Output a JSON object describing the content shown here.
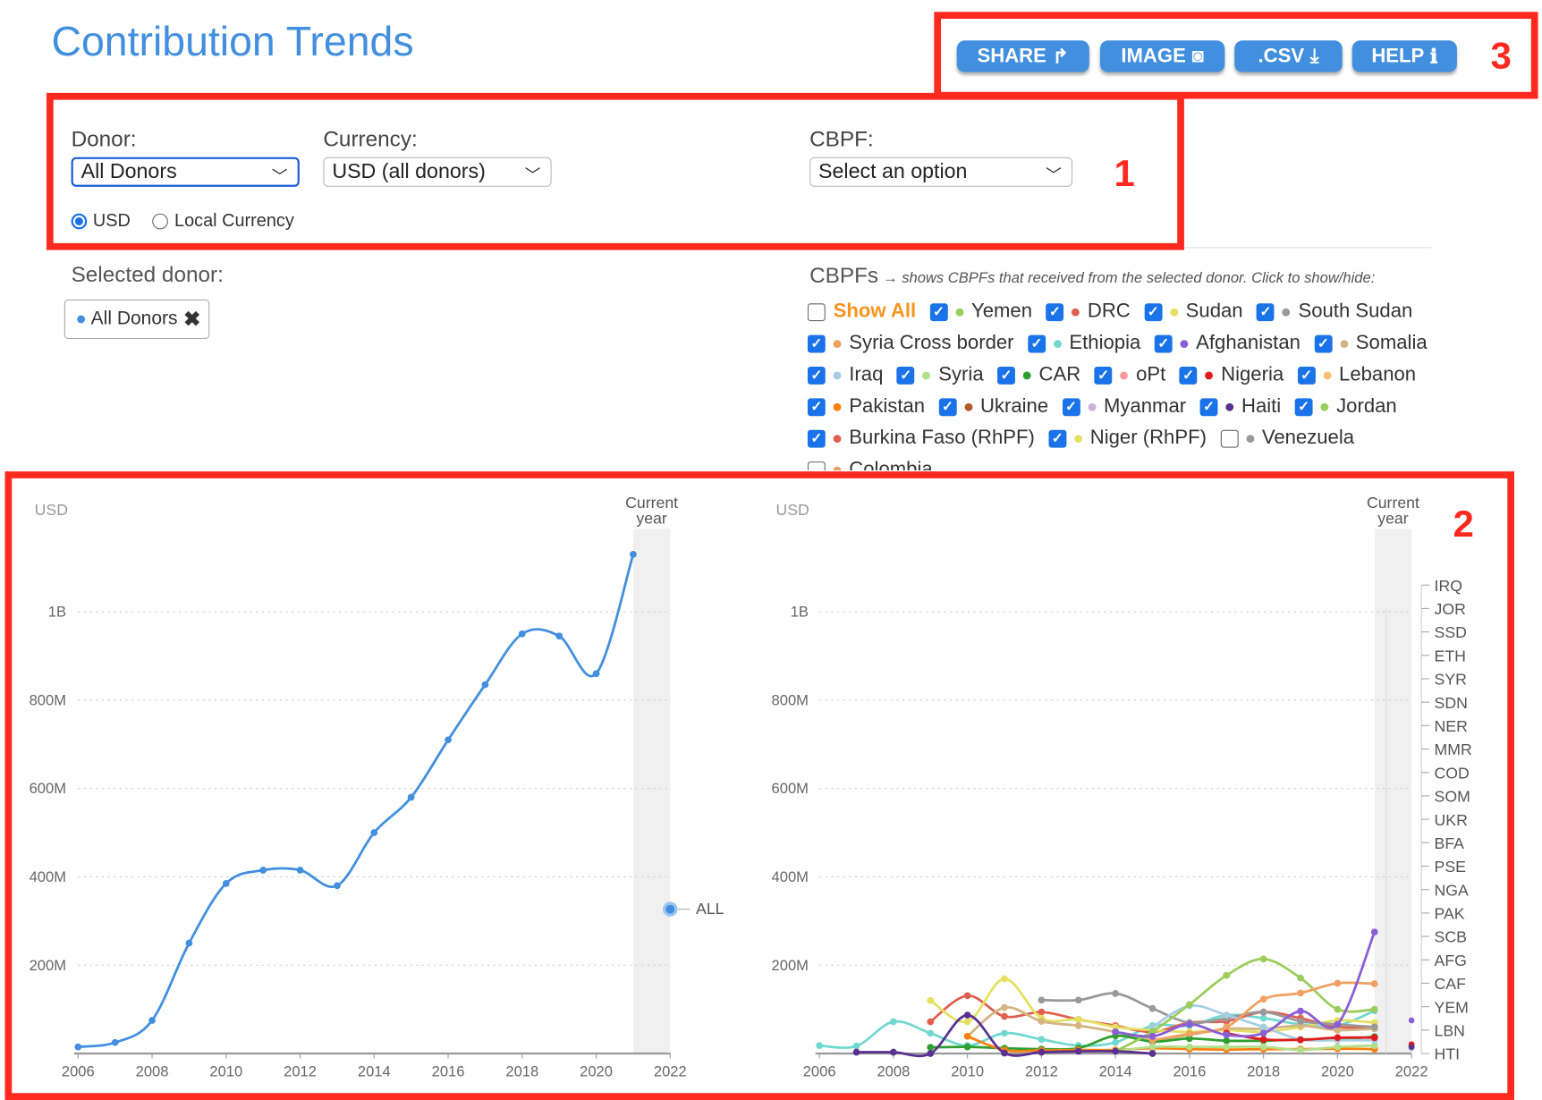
{
  "header": {
    "title": "Contribution Trends"
  },
  "toolbar": {
    "share": "SHARE",
    "image": "IMAGE",
    "csv": ".CSV",
    "help": "HELP",
    "share_icon": "share-arrow",
    "image_icon": "camera",
    "csv_icon": "download",
    "help_icon": "info"
  },
  "annotations": {
    "box1": "1",
    "box2": "2",
    "box3": "3",
    "color": "#ff2a1f"
  },
  "filters": {
    "donor_label": "Donor:",
    "donor_value": "All Donors",
    "currency_label": "Currency:",
    "currency_value": "USD (all donors)",
    "cbpf_label": "CBPF:",
    "cbpf_value": "Select an option",
    "radio_usd": "USD",
    "radio_local": "Local Currency",
    "radio_selected": "USD"
  },
  "selected": {
    "label": "Selected donor:",
    "chip": "All Donors"
  },
  "cbpfs": {
    "title": "CBPFs",
    "note": "→ shows CBPFs that received from the selected donor. Click to show/hide:",
    "show_all": "Show All",
    "items": [
      {
        "label": "Yemen",
        "checked": true,
        "color": "#9acd5a"
      },
      {
        "label": "DRC",
        "checked": true,
        "color": "#e06050"
      },
      {
        "label": "Sudan",
        "checked": true,
        "color": "#e5e060"
      },
      {
        "label": "South Sudan",
        "checked": true,
        "color": "#999999"
      },
      {
        "label": "Syria Cross border",
        "checked": true,
        "color": "#f0a060"
      },
      {
        "label": "Ethiopia",
        "checked": true,
        "color": "#70d8d0"
      },
      {
        "label": "Afghanistan",
        "checked": true,
        "color": "#8a5ed6"
      },
      {
        "label": "Somalia",
        "checked": true,
        "color": "#d4b483"
      },
      {
        "label": "Iraq",
        "checked": true,
        "color": "#a6cee3"
      },
      {
        "label": "Syria",
        "checked": true,
        "color": "#b2df8a"
      },
      {
        "label": "CAR",
        "checked": true,
        "color": "#2ca02c"
      },
      {
        "label": "oPt",
        "checked": true,
        "color": "#fb9a99"
      },
      {
        "label": "Nigeria",
        "checked": true,
        "color": "#e31a1c"
      },
      {
        "label": "Lebanon",
        "checked": true,
        "color": "#fdbf6f"
      },
      {
        "label": "Pakistan",
        "checked": true,
        "color": "#ff7f0e"
      },
      {
        "label": "Ukraine",
        "checked": true,
        "color": "#b15928"
      },
      {
        "label": "Myanmar",
        "checked": true,
        "color": "#cab2d6"
      },
      {
        "label": "Haiti",
        "checked": true,
        "color": "#5a3090"
      },
      {
        "label": "Jordan",
        "checked": true,
        "color": "#9acd5a"
      },
      {
        "label": "Burkina Faso (RhPF)",
        "checked": true,
        "color": "#e06050"
      },
      {
        "label": "Niger (RhPF)",
        "checked": true,
        "color": "#e5e060"
      },
      {
        "label": "Venezuela",
        "checked": false,
        "color": "#999999"
      },
      {
        "label": "Colombia",
        "checked": false,
        "color": "#f0a060"
      }
    ]
  },
  "chart_data": [
    {
      "type": "line",
      "ylabel": "USD",
      "current_year_label": "Current year",
      "xlim": [
        2006,
        2022
      ],
      "ylim": [
        0,
        1250
      ],
      "yticks": [
        "200M",
        "400M",
        "600M",
        "800M",
        "1B"
      ],
      "xticks": [
        2006,
        2008,
        2010,
        2012,
        2014,
        2016,
        2018,
        2020,
        2022
      ],
      "grid": true,
      "legend": "right",
      "series": [
        {
          "name": "ALL",
          "color": "#418fde",
          "x": [
            2006,
            2007,
            2008,
            2009,
            2010,
            2011,
            2012,
            2013,
            2014,
            2015,
            2016,
            2017,
            2018,
            2019,
            2020,
            2021
          ],
          "values": [
            15,
            25,
            75,
            250,
            385,
            415,
            415,
            380,
            500,
            580,
            710,
            835,
            950,
            945,
            860,
            1130
          ]
        }
      ]
    },
    {
      "type": "line",
      "ylabel": "USD",
      "current_year_label": "Current year",
      "xlim": [
        2006,
        2022
      ],
      "ylim": [
        0,
        1250
      ],
      "yticks": [
        "200M",
        "400M",
        "600M",
        "800M",
        "1B"
      ],
      "xticks": [
        2006,
        2008,
        2010,
        2012,
        2014,
        2016,
        2018,
        2020,
        2022
      ],
      "grid": true,
      "legend": "right",
      "legend_labels": [
        "IRQ",
        "JOR",
        "SSD",
        "ETH",
        "SYR",
        "SDN",
        "NER",
        "MMR",
        "COD",
        "SOM",
        "UKR",
        "BFA",
        "PSE",
        "NGA",
        "PAK",
        "SCB",
        "AFG",
        "CAF",
        "YEM",
        "LBN",
        "HTI"
      ],
      "series": [
        {
          "color": "#70d8d0",
          "x": [
            2006,
            2007,
            2008,
            2009,
            2010,
            2011,
            2012,
            2013,
            2014,
            2015,
            2016,
            2017,
            2018,
            2019,
            2020,
            2021
          ],
          "values": [
            18,
            17,
            72,
            46,
            18,
            46,
            32,
            18,
            25,
            63,
            63,
            87,
            80,
            66,
            63,
            97
          ]
        },
        {
          "color": "#e06050",
          "x": [
            2009,
            2010,
            2011,
            2012,
            2013,
            2014,
            2015,
            2016,
            2017,
            2018,
            2019,
            2020,
            2021
          ],
          "values": [
            72,
            131,
            84,
            94,
            77,
            63,
            49,
            70,
            73,
            94,
            80,
            60,
            60
          ]
        },
        {
          "color": "#e5e060",
          "x": [
            2009,
            2010,
            2011,
            2012,
            2013,
            2014,
            2015,
            2016,
            2017,
            2018,
            2019,
            2020,
            2021
          ],
          "values": [
            120,
            72,
            169,
            80,
            77,
            60,
            53,
            49,
            53,
            49,
            60,
            75,
            70
          ]
        },
        {
          "color": "#d4b483",
          "x": [
            2010,
            2011,
            2012,
            2013,
            2014,
            2015,
            2016,
            2017,
            2018,
            2019,
            2020,
            2021
          ],
          "values": [
            39,
            104,
            73,
            63,
            49,
            32,
            42,
            56,
            56,
            63,
            53,
            56
          ]
        },
        {
          "color": "#999999",
          "x": [
            2012,
            2013,
            2014,
            2015,
            2016,
            2017,
            2018,
            2019,
            2020,
            2021
          ],
          "values": [
            121,
            121,
            136,
            102,
            70,
            80,
            94,
            73,
            66,
            60
          ]
        },
        {
          "color": "#2ca02c",
          "x": [
            2009,
            2010,
            2011,
            2012,
            2013,
            2014,
            2015,
            2016,
            2017,
            2018,
            2019,
            2020,
            2021
          ],
          "values": [
            14,
            15,
            12,
            10,
            12,
            40,
            27,
            34,
            29,
            29,
            32,
            32,
            38
          ]
        },
        {
          "color": "#ff7f0e",
          "x": [
            2010,
            2011,
            2012,
            2013,
            2014,
            2015,
            2016,
            2017,
            2018,
            2019,
            2020,
            2021
          ],
          "values": [
            39,
            8,
            7,
            8,
            8,
            12,
            10,
            9,
            10,
            10,
            11,
            10
          ]
        },
        {
          "color": "#b2df8a",
          "x": [
            2014,
            2015,
            2016,
            2017,
            2018,
            2019,
            2020,
            2021
          ],
          "values": [
            5,
            15,
            15,
            15,
            15,
            8,
            15,
            18
          ]
        },
        {
          "color": "#a6cee3",
          "x": [
            2015,
            2016,
            2017,
            2018,
            2019,
            2020,
            2021
          ],
          "values": [
            60,
            108,
            87,
            60,
            32,
            30,
            30
          ]
        },
        {
          "color": "#9acd5a",
          "x": [
            2014,
            2015,
            2016,
            2017,
            2018,
            2019,
            2020,
            2021
          ],
          "values": [
            5,
            50,
            111,
            177,
            214,
            171,
            100,
            100
          ]
        },
        {
          "color": "#f0a060",
          "x": [
            2015,
            2016,
            2017,
            2018,
            2019,
            2020,
            2021
          ],
          "values": [
            30,
            45,
            60,
            123,
            137,
            159,
            158
          ]
        },
        {
          "color": "#e31a1c",
          "x": [
            2017,
            2018,
            2019,
            2020,
            2021
          ],
          "values": [
            46,
            32,
            31,
            36,
            36
          ]
        },
        {
          "color": "#8a5ed6",
          "x": [
            2014,
            2015,
            2016,
            2017,
            2018,
            2019,
            2020,
            2021
          ],
          "values": [
            49,
            39,
            66,
            42,
            46,
            96,
            66,
            275
          ]
        },
        {
          "color": "#5a3090",
          "x": [
            2007,
            2008,
            2009,
            2010,
            2011,
            2012,
            2013,
            2014,
            2015
          ],
          "values": [
            3,
            3,
            0,
            87,
            1,
            3,
            5,
            5,
            0
          ]
        }
      ]
    }
  ]
}
